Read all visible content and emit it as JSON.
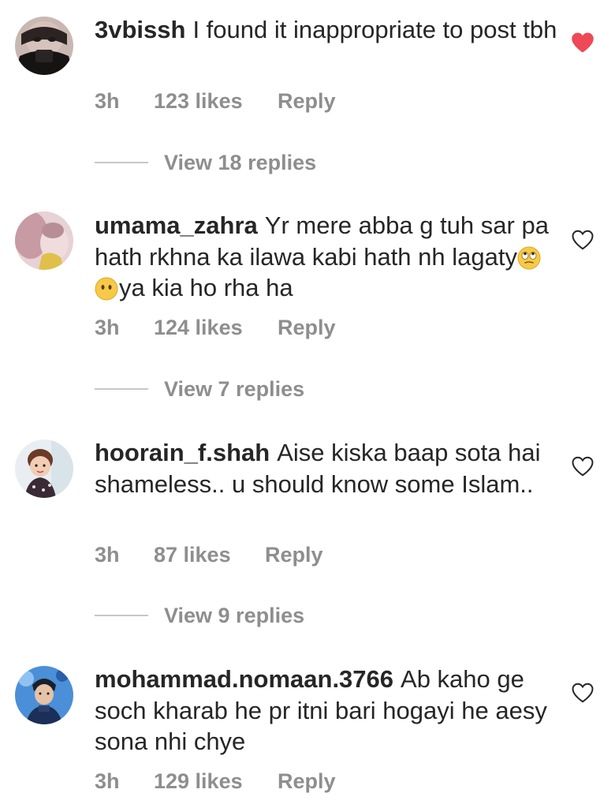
{
  "comments": [
    {
      "username": "3vbissh",
      "text": "I found it inappropriate to post tbh",
      "time": "3h",
      "likes": "123 likes",
      "reply_label": "Reply",
      "liked": true,
      "view_replies": "View 18 replies"
    },
    {
      "username": "umama_zahra",
      "text_a": "Yr mere abba g tuh sar pa hath rkhna ka ilawa kabi hath nh lagaty",
      "text_b": "ya kia ho rha ha",
      "emojis": [
        "face-with-rolling-eyes-emoji",
        "face-without-mouth-emoji"
      ],
      "time": "3h",
      "likes": "124 likes",
      "reply_label": "Reply",
      "liked": false,
      "view_replies": "View 7 replies"
    },
    {
      "username": "hoorain_f.shah",
      "text": "Aise kiska baap sota hai shameless.. u should know some Islam..",
      "time": "3h",
      "likes": "87 likes",
      "reply_label": "Reply",
      "liked": false,
      "view_replies": "View 9 replies"
    },
    {
      "username": "mohammad.nomaan.3766",
      "text": "Ab kaho ge soch kharab he pr itni bari hogayi he aesy sona nhi chye",
      "time": "3h",
      "likes": "129 likes",
      "reply_label": "Reply",
      "liked": false
    }
  ],
  "colors": {
    "text": "#262626",
    "secondary": "#8e8e8e",
    "liked_heart": "#ed4956",
    "divider": "#c7c7c7"
  }
}
